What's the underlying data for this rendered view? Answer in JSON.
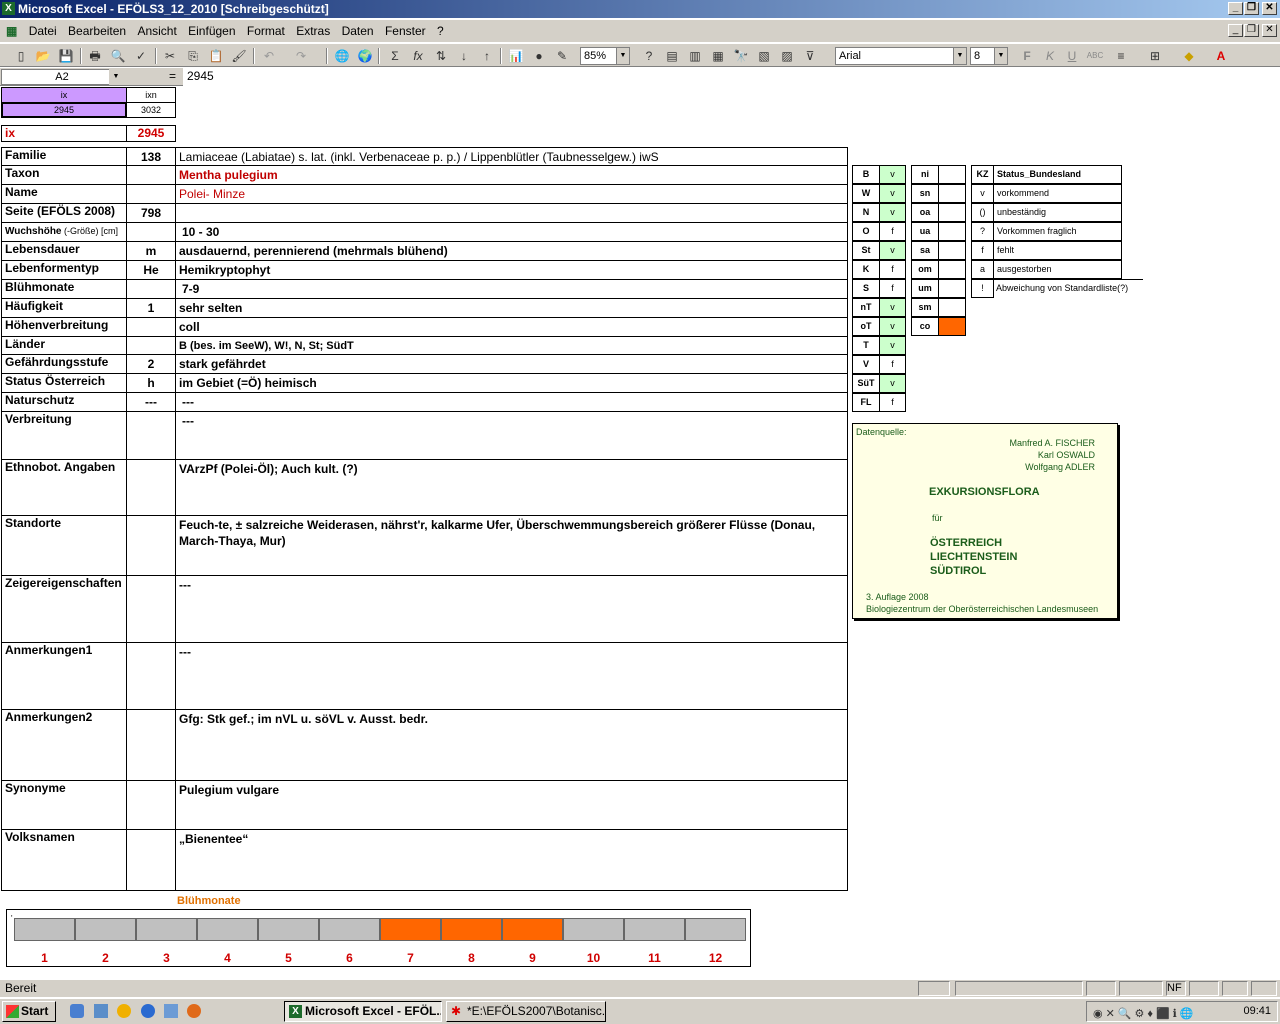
{
  "window": {
    "title": "Microsoft Excel - EFÖLS3_12_2010  [Schreibgeschützt]"
  },
  "menu": [
    "Datei",
    "Bearbeiten",
    "Ansicht",
    "Einfügen",
    "Format",
    "Extras",
    "Daten",
    "Fenster",
    "?"
  ],
  "toolbar": {
    "zoom": "85%",
    "font": "Arial",
    "size": "8"
  },
  "formula": {
    "namebox": "A2",
    "eq": "=",
    "value": "2945"
  },
  "header_cells": {
    "ix_label": "ix",
    "ixn_label": "ixn",
    "ix_value": "2945",
    "ixn_value": "3032",
    "ix_title": "ix",
    "ix_big": "2945"
  },
  "fields": [
    {
      "label": "Familie",
      "num": "138",
      "value": "Lamiaceae (Labiatae) s. lat. (inkl. Verbenaceae p. p.)  /  Lippenblütler (Taubnesselgew.) iwS"
    },
    {
      "label": "Taxon",
      "num": "",
      "value": "Mentha pulegium"
    },
    {
      "label": "Name",
      "num": "",
      "value": "Polei- Minze"
    },
    {
      "label": "Seite (EFÖLS 2008)",
      "num": "798",
      "value": ""
    },
    {
      "label": "Wuchshöhe",
      "label_small": "(-Größe) [cm]",
      "num": "",
      "value": "10 - 30"
    },
    {
      "label": "Lebensdauer",
      "num": "m",
      "value": "ausdauernd, perennierend (mehrmals blühend)"
    },
    {
      "label": "Lebenformentyp",
      "num": "He",
      "value": "Hemikryptophyt"
    },
    {
      "label": "Blühmonate",
      "num": "",
      "value": "7-9"
    },
    {
      "label": "Häufigkeit",
      "num": "1",
      "value": "sehr selten"
    },
    {
      "label": "Höhenverbreitung",
      "num": "",
      "value": "coll"
    },
    {
      "label": "Länder",
      "num": "",
      "value": "B (bes. im SeeW), W!, N, St; SüdT"
    },
    {
      "label": "Gefährdungsstufe",
      "num": "2",
      "value": "stark gefährdet"
    },
    {
      "label": "Status Österreich",
      "num": "h",
      "value": "im Gebiet (=Ö) heimisch"
    },
    {
      "label": "Naturschutz",
      "num": "---",
      "value": "---"
    },
    {
      "label": "Verbreitung",
      "num": "",
      "value": "---"
    },
    {
      "label": "Ethnobot. Angaben",
      "num": "",
      "value": "VArzPf (Polei-Öl);  Auch kult. (?)"
    },
    {
      "label": "Standorte",
      "num": "",
      "value": "Feuch-te, ± salzreiche Weiderasen, nährst'r, kalkarme Ufer, Überschwemmungsbereich größerer Flüsse (Donau,",
      "value2": "March-Thaya, Mur)"
    },
    {
      "label": "Zeigereigenschaften",
      "num": "",
      "value": "---"
    },
    {
      "label": "Anmerkungen1",
      "num": "",
      "value": "---"
    },
    {
      "label": "Anmerkungen2",
      "num": "",
      "value": "Gfg: Stk gef.; im nVL u. söVL v. Ausst. bedr."
    },
    {
      "label": "Synonyme",
      "num": "",
      "value": "Pulegium vulgare"
    },
    {
      "label": "Volksnamen",
      "num": "",
      "value": "„Bienentee“"
    }
  ],
  "states": [
    {
      "kz": "B",
      "v": "v"
    },
    {
      "kz": "W",
      "v": "v"
    },
    {
      "kz": "N",
      "v": "v"
    },
    {
      "kz": "O",
      "v": "f"
    },
    {
      "kz": "St",
      "v": "v"
    },
    {
      "kz": "K",
      "v": "f"
    },
    {
      "kz": "S",
      "v": "f"
    },
    {
      "kz": "nT",
      "v": "v"
    },
    {
      "kz": "oT",
      "v": "v"
    },
    {
      "kz": "T",
      "v": "v"
    },
    {
      "kz": "V",
      "v": "f"
    },
    {
      "kz": "SüT",
      "v": "v"
    },
    {
      "kz": "FL",
      "v": "f"
    }
  ],
  "altitudes": [
    "ni",
    "sn",
    "oa",
    "ua",
    "sa",
    "om",
    "um",
    "sm",
    "co"
  ],
  "legend": {
    "kz_header": "KZ",
    "status_header": "Status_Bundesland",
    "rows": [
      {
        "kz": "v",
        "text": "vorkommend"
      },
      {
        "kz": "()",
        "text": "unbeständig"
      },
      {
        "kz": "?",
        "text": "Vorkommen fraglich"
      },
      {
        "kz": "f",
        "text": "fehlt"
      },
      {
        "kz": "a",
        "text": "ausgestorben"
      },
      {
        "kz": "!",
        "text": "Abweichung von Standardliste(?)"
      }
    ]
  },
  "source": {
    "label": "Datenquelle:",
    "authors": [
      "Manfred A. FISCHER",
      "Karl OSWALD",
      "Wolfgang ADLER"
    ],
    "title": "EXKURSIONSFLORA",
    "fuer": "für",
    "countries": [
      "ÖSTERREICH",
      "LIECHTENSTEIN",
      "SÜDTIROL"
    ],
    "edition": "3. Auflage 2008",
    "publisher": "Biologiezentrum der Oberösterreichischen Landesmuseen"
  },
  "bloom": {
    "title": "Blühmonate",
    "months": [
      "1",
      "2",
      "3",
      "4",
      "5",
      "6",
      "7",
      "8",
      "9",
      "10",
      "11",
      "12"
    ],
    "active": [
      7,
      8,
      9
    ]
  },
  "colors": {
    "active_month": "#ff6600",
    "inactive_month": "#c0c0c0",
    "green_cell": "#ccffcc",
    "lavender": "#cc99ff"
  },
  "statusbar": {
    "text": "Bereit",
    "nf": "NF"
  },
  "taskbar": {
    "start": "Start",
    "task1": "Microsoft Excel - EFÖL...",
    "task2": "*E:\\EFÖLS2007\\Botanisc...",
    "clock": "09:41"
  }
}
